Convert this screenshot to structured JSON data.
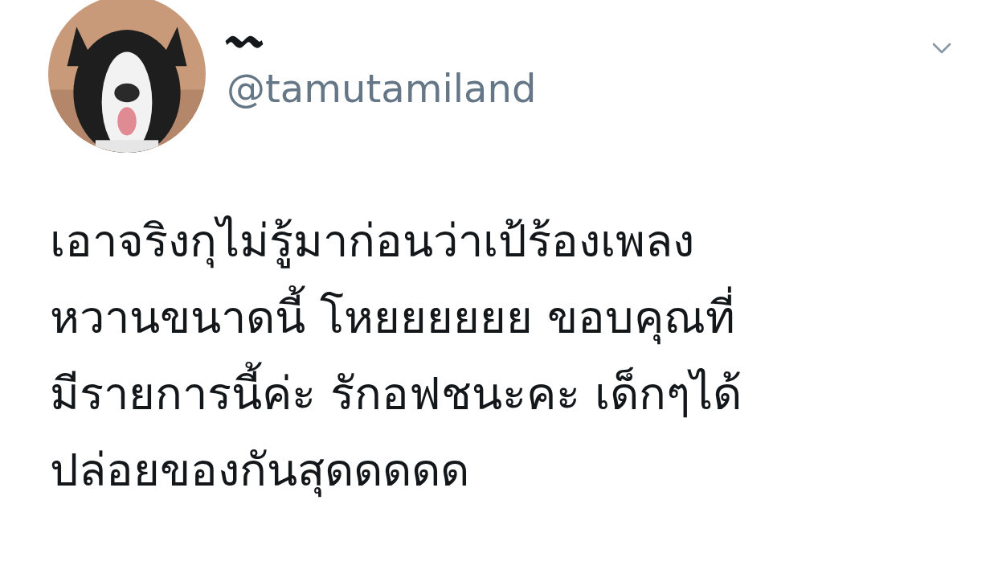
{
  "tweet": {
    "display_name": "〰",
    "handle": "@tamutamiland",
    "text": "เอาจริงกุไม่รู้มาก่อนว่าเป้ร้องเพลง\nหวานขนาดนี้ โหยยยยยย ขอบคุณที่\nมีรายการนี้ค่ะ รักอฟชนะคะ เด็กๆได้\nปล่อยของกันสุดดดดด"
  }
}
